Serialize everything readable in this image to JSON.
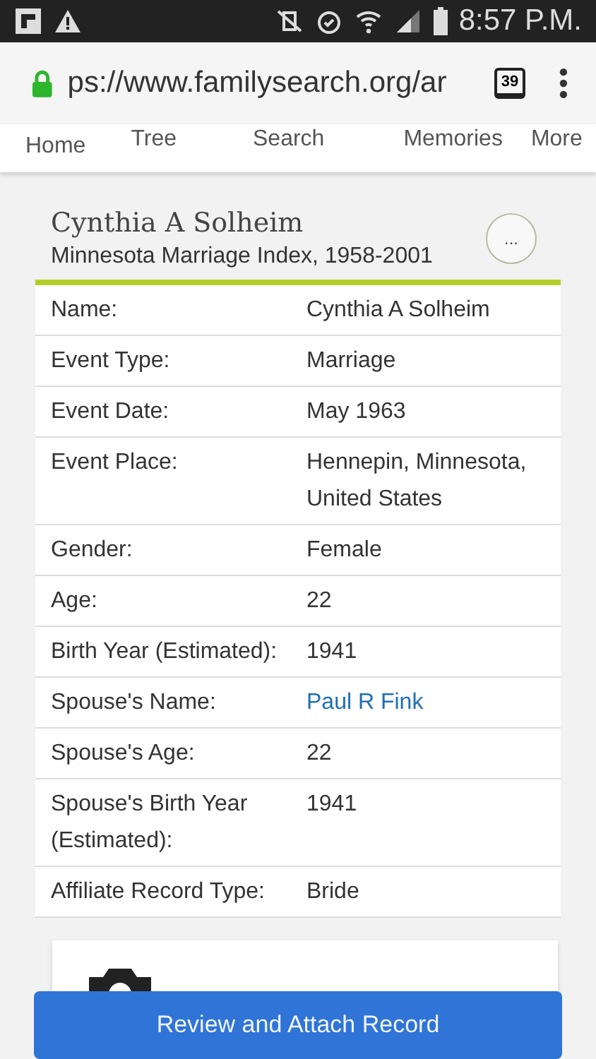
{
  "status_bar": {
    "time": "8:57 P.M."
  },
  "browser": {
    "url": "ps://www.familysearch.org/ar",
    "tab_count": "39"
  },
  "nav": [
    {
      "label": "Home"
    },
    {
      "label": "Tree"
    },
    {
      "label": "Search"
    },
    {
      "label": "Memories"
    },
    {
      "label": "More"
    }
  ],
  "record": {
    "name": "Cynthia A Solheim",
    "collection": "Minnesota Marriage Index, 1958-2001",
    "more_button": "..."
  },
  "fields": [
    {
      "label": "Name:",
      "value": "Cynthia A Solheim",
      "kind": "text"
    },
    {
      "label": "Event Type:",
      "value": "Marriage",
      "kind": "text"
    },
    {
      "label": "Event Date:",
      "value": "May 1963",
      "kind": "text"
    },
    {
      "label": "Event Place:",
      "value": "Hennepin, Minnesota, United States",
      "kind": "text"
    },
    {
      "label": "Gender:",
      "value": "Female",
      "kind": "text"
    },
    {
      "label": "Age:",
      "value": "22",
      "kind": "text"
    },
    {
      "label": "Birth Year (Estimated):",
      "value": "1941",
      "kind": "text"
    },
    {
      "label": "Spouse's Name:",
      "value": "Paul R Fink",
      "kind": "link"
    },
    {
      "label": "Spouse's Age:",
      "value": "22",
      "kind": "text"
    },
    {
      "label": "Spouse's Birth Year (Estimated):",
      "value": "1941",
      "kind": "text"
    },
    {
      "label": "Affiliate Record Type:",
      "value": "Bride",
      "kind": "text"
    }
  ],
  "action_button": "Review and Attach Record"
}
